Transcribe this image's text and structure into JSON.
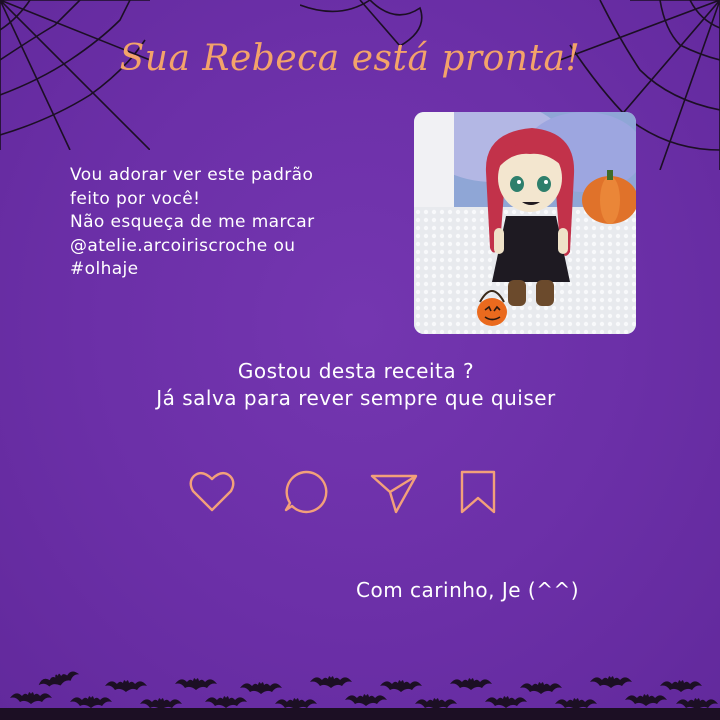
{
  "title": "Sua Rebeca está pronta!",
  "message_lines": [
    "Vou adorar ver este padrão",
    "feito por você!",
    "Não esqueça de me marcar",
    "@atelie.arcoiriscroche ou",
    "#olhaje"
  ],
  "question_lines": [
    "Gostou desta receita ?",
    "Já salva para rever sempre que quiser"
  ],
  "signature": "Com carinho, Je (^^)",
  "actions": [
    "heart-icon",
    "comment-icon",
    "send-icon",
    "bookmark-icon"
  ],
  "colors": {
    "background": "#6b2fa7",
    "title": "#f3a36a",
    "icon_stroke": "#f3a07a",
    "text": "#ffffff",
    "decor": "#1c0f24"
  }
}
